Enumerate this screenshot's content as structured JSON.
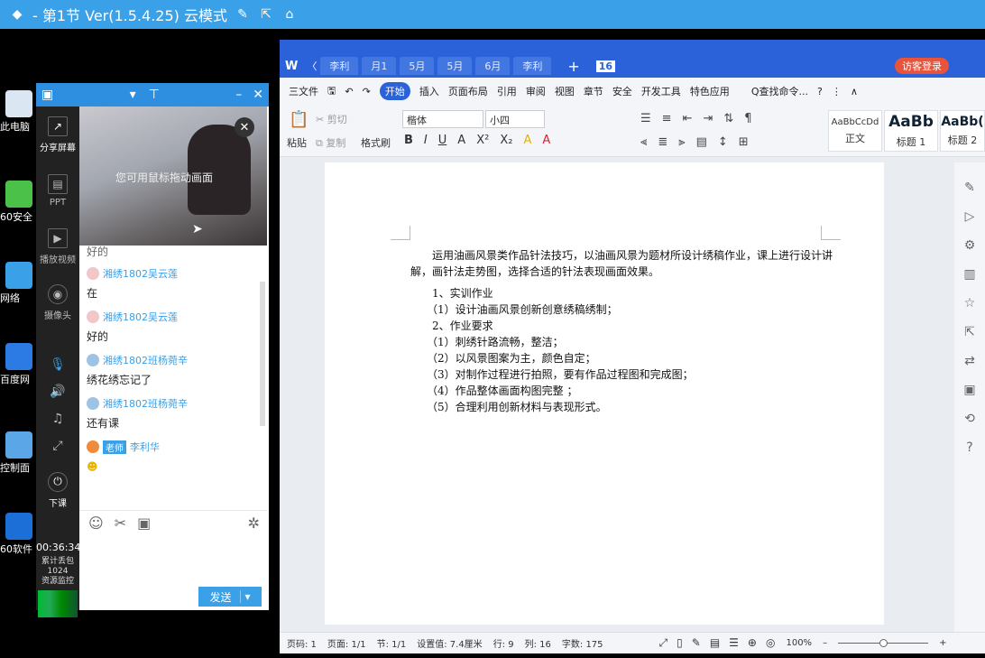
{
  "topbar": {
    "title": "- 第1节 Ver(1.5.4.25) 云模式"
  },
  "desktop": {
    "icons": [
      "此电脑",
      "60安全",
      "网络",
      "百度网",
      "控制面",
      "60软件"
    ]
  },
  "live": {
    "sidebar": [
      "分享屏幕",
      "PPT",
      "播放视频",
      "摄像头",
      "下课"
    ],
    "video_hint": "您可用鼠标拖动画面",
    "timer": "00:36:34",
    "stats": [
      "累计丢包",
      "1024",
      "资源监控"
    ],
    "chat": [
      {
        "user": "",
        "text": "好的"
      },
      {
        "user": "湘绣1802吴云莲",
        "text": "在"
      },
      {
        "user": "湘绣1802吴云莲",
        "text": "好的"
      },
      {
        "user": "湘绣1802班杨菀辛",
        "text": "绣花绣忘记了"
      },
      {
        "user": "湘绣1802班杨菀辛",
        "text": "还有课"
      },
      {
        "user": "李利华",
        "text": ""
      }
    ],
    "teacher_badge": "老师",
    "send_label": "发送"
  },
  "wps": {
    "tabs": [
      "李利",
      "月1",
      "5月",
      "5月",
      "6月",
      "李利"
    ],
    "login": "访客登录",
    "number": "16",
    "menu": [
      "三文件",
      "开始",
      "插入",
      "页面布局",
      "引用",
      "审阅",
      "视图",
      "章节",
      "安全",
      "开发工具",
      "特色应用"
    ],
    "search": "Q查找命令...",
    "ribbon": {
      "font": "楷体",
      "size": "小四",
      "paste": "粘贴",
      "cut": "剪切",
      "copy": "复制",
      "painter": "格式刷",
      "styles": [
        {
          "preview": "AaBbCcDd",
          "name": "正文"
        },
        {
          "preview": "AaBb",
          "name": "标题 1"
        },
        {
          "preview": "AaBb(",
          "name": "标题 2"
        }
      ]
    },
    "doc": {
      "intro": "运用油画风景类作品针法技巧，以油画风景为题材所设计绣稿作业，课上进行设计讲解，画针法走势图，选择合适的针法表现画面效果。",
      "lines": [
        "1、实训作业",
        "（1）设计油画风景创新创意绣稿绣制；",
        "2、作业要求",
        "（1）刺绣针路流畅，整洁；",
        "（2）以风景图案为主，颜色自定；",
        "（3）对制作过程进行拍照，要有作品过程图和完成图；",
        "（4）作品整体画面构图完整 ；",
        "（5）合理利用创新材料与表现形式。"
      ]
    },
    "status": {
      "page": "页码: 1",
      "pages": "页面: 1/1",
      "section": "节: 1/1",
      "setting": "设置值: 7.4厘米",
      "row": "行: 9",
      "col": "列: 16",
      "words": "字数: 175",
      "zoom": "100%"
    }
  }
}
